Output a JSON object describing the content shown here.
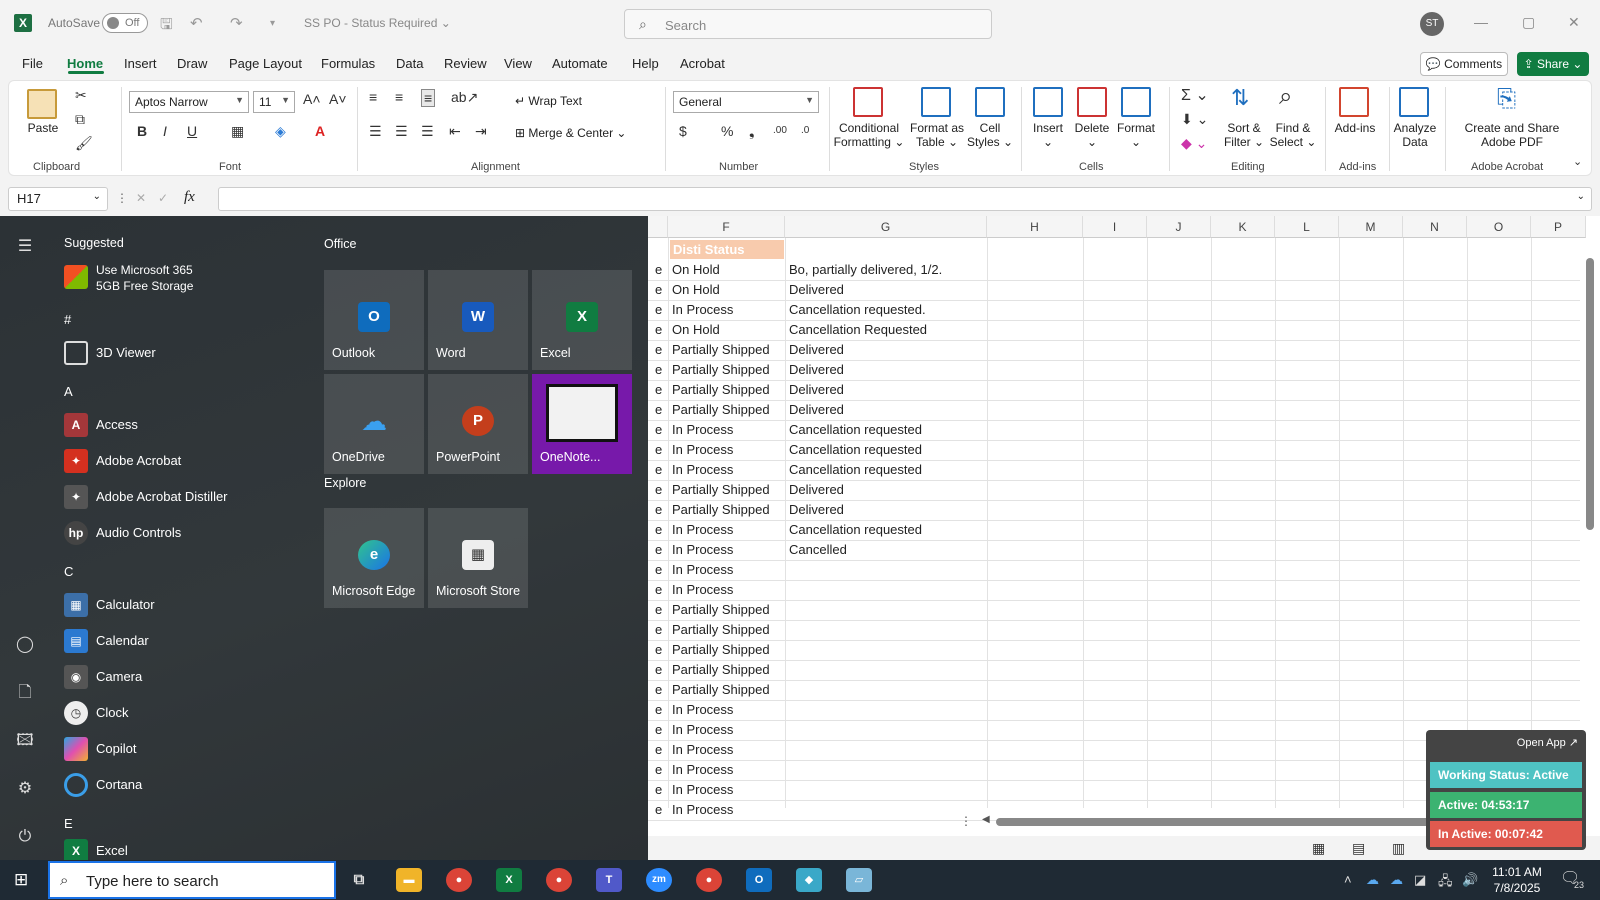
{
  "titlebar": {
    "autosave_label": "AutoSave",
    "autosave_state": "Off",
    "doc_title": "SS PO - Status Required",
    "search_placeholder": "Search",
    "user_initials": "ST"
  },
  "menu": {
    "items": [
      "File",
      "Home",
      "Insert",
      "Draw",
      "Page Layout",
      "Formulas",
      "Data",
      "Review",
      "View",
      "Automate",
      "Help",
      "Acrobat"
    ],
    "active": "Home",
    "comments_label": "Comments",
    "share_label": "Share"
  },
  "ribbon": {
    "clipboard": {
      "paste": "Paste",
      "group": "Clipboard"
    },
    "font": {
      "name": "Aptos Narrow",
      "size": "11",
      "group": "Font"
    },
    "alignment": {
      "wrap_text": "Wrap Text",
      "merge_center": "Merge & Center",
      "group": "Alignment"
    },
    "number": {
      "format": "General",
      "group": "Number"
    },
    "styles": {
      "conditional": "Conditional",
      "formatting": "Formatting",
      "format_as": "Format as",
      "table": "Table",
      "cell": "Cell",
      "cell_styles": "Styles",
      "group": "Styles"
    },
    "cells": {
      "insert": "Insert",
      "delete": "Delete",
      "format": "Format",
      "group": "Cells"
    },
    "editing": {
      "sort": "Sort &",
      "filter": "Filter",
      "find": "Find &",
      "select": "Select",
      "group": "Editing"
    },
    "addins": {
      "label": "Add-ins",
      "group": "Add-ins"
    },
    "analyze": {
      "line1": "Analyze",
      "line2": "Data"
    },
    "acrobat": {
      "line1": "Create and Share",
      "line2": "Adobe PDF",
      "group": "Adobe Acrobat"
    }
  },
  "formula_bar": {
    "name_box": "H17",
    "fx": "fx",
    "content": ""
  },
  "grid": {
    "columns": [
      "F",
      "G",
      "H",
      "I",
      "J",
      "K",
      "L",
      "M",
      "N",
      "O",
      "P"
    ],
    "header_cell": "Disti Status",
    "col_e_fragment": "e",
    "rows": [
      [
        "On Hold",
        "Bo, partially delivered, 1/2."
      ],
      [
        "On Hold",
        "Delivered"
      ],
      [
        "In Process",
        "Cancellation requested."
      ],
      [
        "On Hold",
        "Cancellation Requested"
      ],
      [
        "Partially Shipped",
        "Delivered"
      ],
      [
        "Partially Shipped",
        "Delivered"
      ],
      [
        "Partially Shipped",
        "Delivered"
      ],
      [
        "Partially Shipped",
        "Delivered"
      ],
      [
        "In Process",
        "Cancellation requested"
      ],
      [
        "In Process",
        "Cancellation requested"
      ],
      [
        "In Process",
        "Cancellation requested"
      ],
      [
        "Partially Shipped",
        "Delivered"
      ],
      [
        "Partially Shipped",
        "Delivered"
      ],
      [
        "In Process",
        "Cancellation requested"
      ],
      [
        "In Process",
        "Cancelled"
      ],
      [
        "In Process",
        ""
      ],
      [
        "In Process",
        ""
      ],
      [
        "Partially Shipped",
        ""
      ],
      [
        "Partially Shipped",
        ""
      ],
      [
        "Partially Shipped",
        ""
      ],
      [
        "Partially Shipped",
        ""
      ],
      [
        "Partially Shipped",
        ""
      ],
      [
        "In Process",
        ""
      ],
      [
        "In Process",
        ""
      ],
      [
        "In Process",
        ""
      ],
      [
        "In Process",
        ""
      ],
      [
        "In Process",
        ""
      ],
      [
        "In Process",
        ""
      ]
    ]
  },
  "start_menu": {
    "suggested_label": "Suggested",
    "suggested_app_line1": "Use Microsoft 365",
    "suggested_app_line2": "5GB Free Storage",
    "sections": [
      "#",
      "A",
      "C",
      "E"
    ],
    "apps": {
      "hash": [
        "3D Viewer"
      ],
      "a": [
        "Access",
        "Adobe Acrobat",
        "Adobe Acrobat Distiller",
        "Audio Controls"
      ],
      "c": [
        "Calculator",
        "Calendar",
        "Camera",
        "Clock",
        "Copilot",
        "Cortana"
      ],
      "e": [
        "Excel"
      ]
    },
    "office_label": "Office",
    "tiles": [
      "Outlook",
      "Word",
      "Excel",
      "OneDrive",
      "PowerPoint",
      "OneNote..."
    ],
    "explore_label": "Explore",
    "explore_tiles": [
      "Microsoft Edge",
      "Microsoft Store"
    ]
  },
  "widget": {
    "open_app": "Open App ↗",
    "working_status": "Working Status: Active",
    "active": "Active: 04:53:17",
    "inactive": "In Active: 00:07:42"
  },
  "taskbar": {
    "search_placeholder": "Type here to search",
    "time": "11:01 AM",
    "date": "7/8/2025",
    "notification_count": "23",
    "zoom_label": "zm"
  },
  "colors": {
    "excel_green": "#107c41",
    "header_fill": "#f8cbad",
    "widget_status": "#4fc3c3",
    "widget_active": "#3cb371",
    "widget_inactive": "#e05a4f"
  }
}
